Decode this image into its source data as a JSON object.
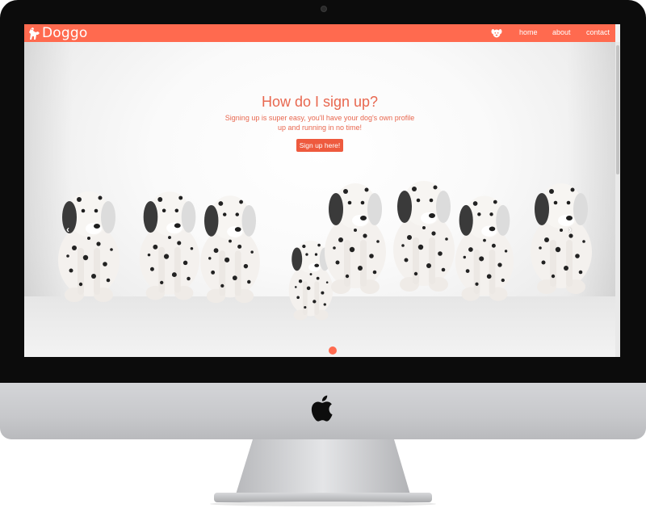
{
  "brand": {
    "name": "Doggo",
    "logo_icon": "dog-silhouette-icon"
  },
  "nav": {
    "paw_icon": "dog-face-icon",
    "links": [
      "home",
      "about",
      "contact"
    ]
  },
  "hero": {
    "title": "How do I sign up?",
    "subtitle_line1": "Signing up is super easy, you'll have your dog's own profile",
    "subtitle_line2": "up and running in no time!",
    "cta_label": "Sign up here!",
    "prev_arrow": "‹",
    "next_arrow": "›",
    "active_slide": 1,
    "slide_count": 1
  },
  "colors": {
    "accent": "#ff6a4f",
    "text_accent": "#e8674f",
    "bezel": "#0c0c0c"
  }
}
